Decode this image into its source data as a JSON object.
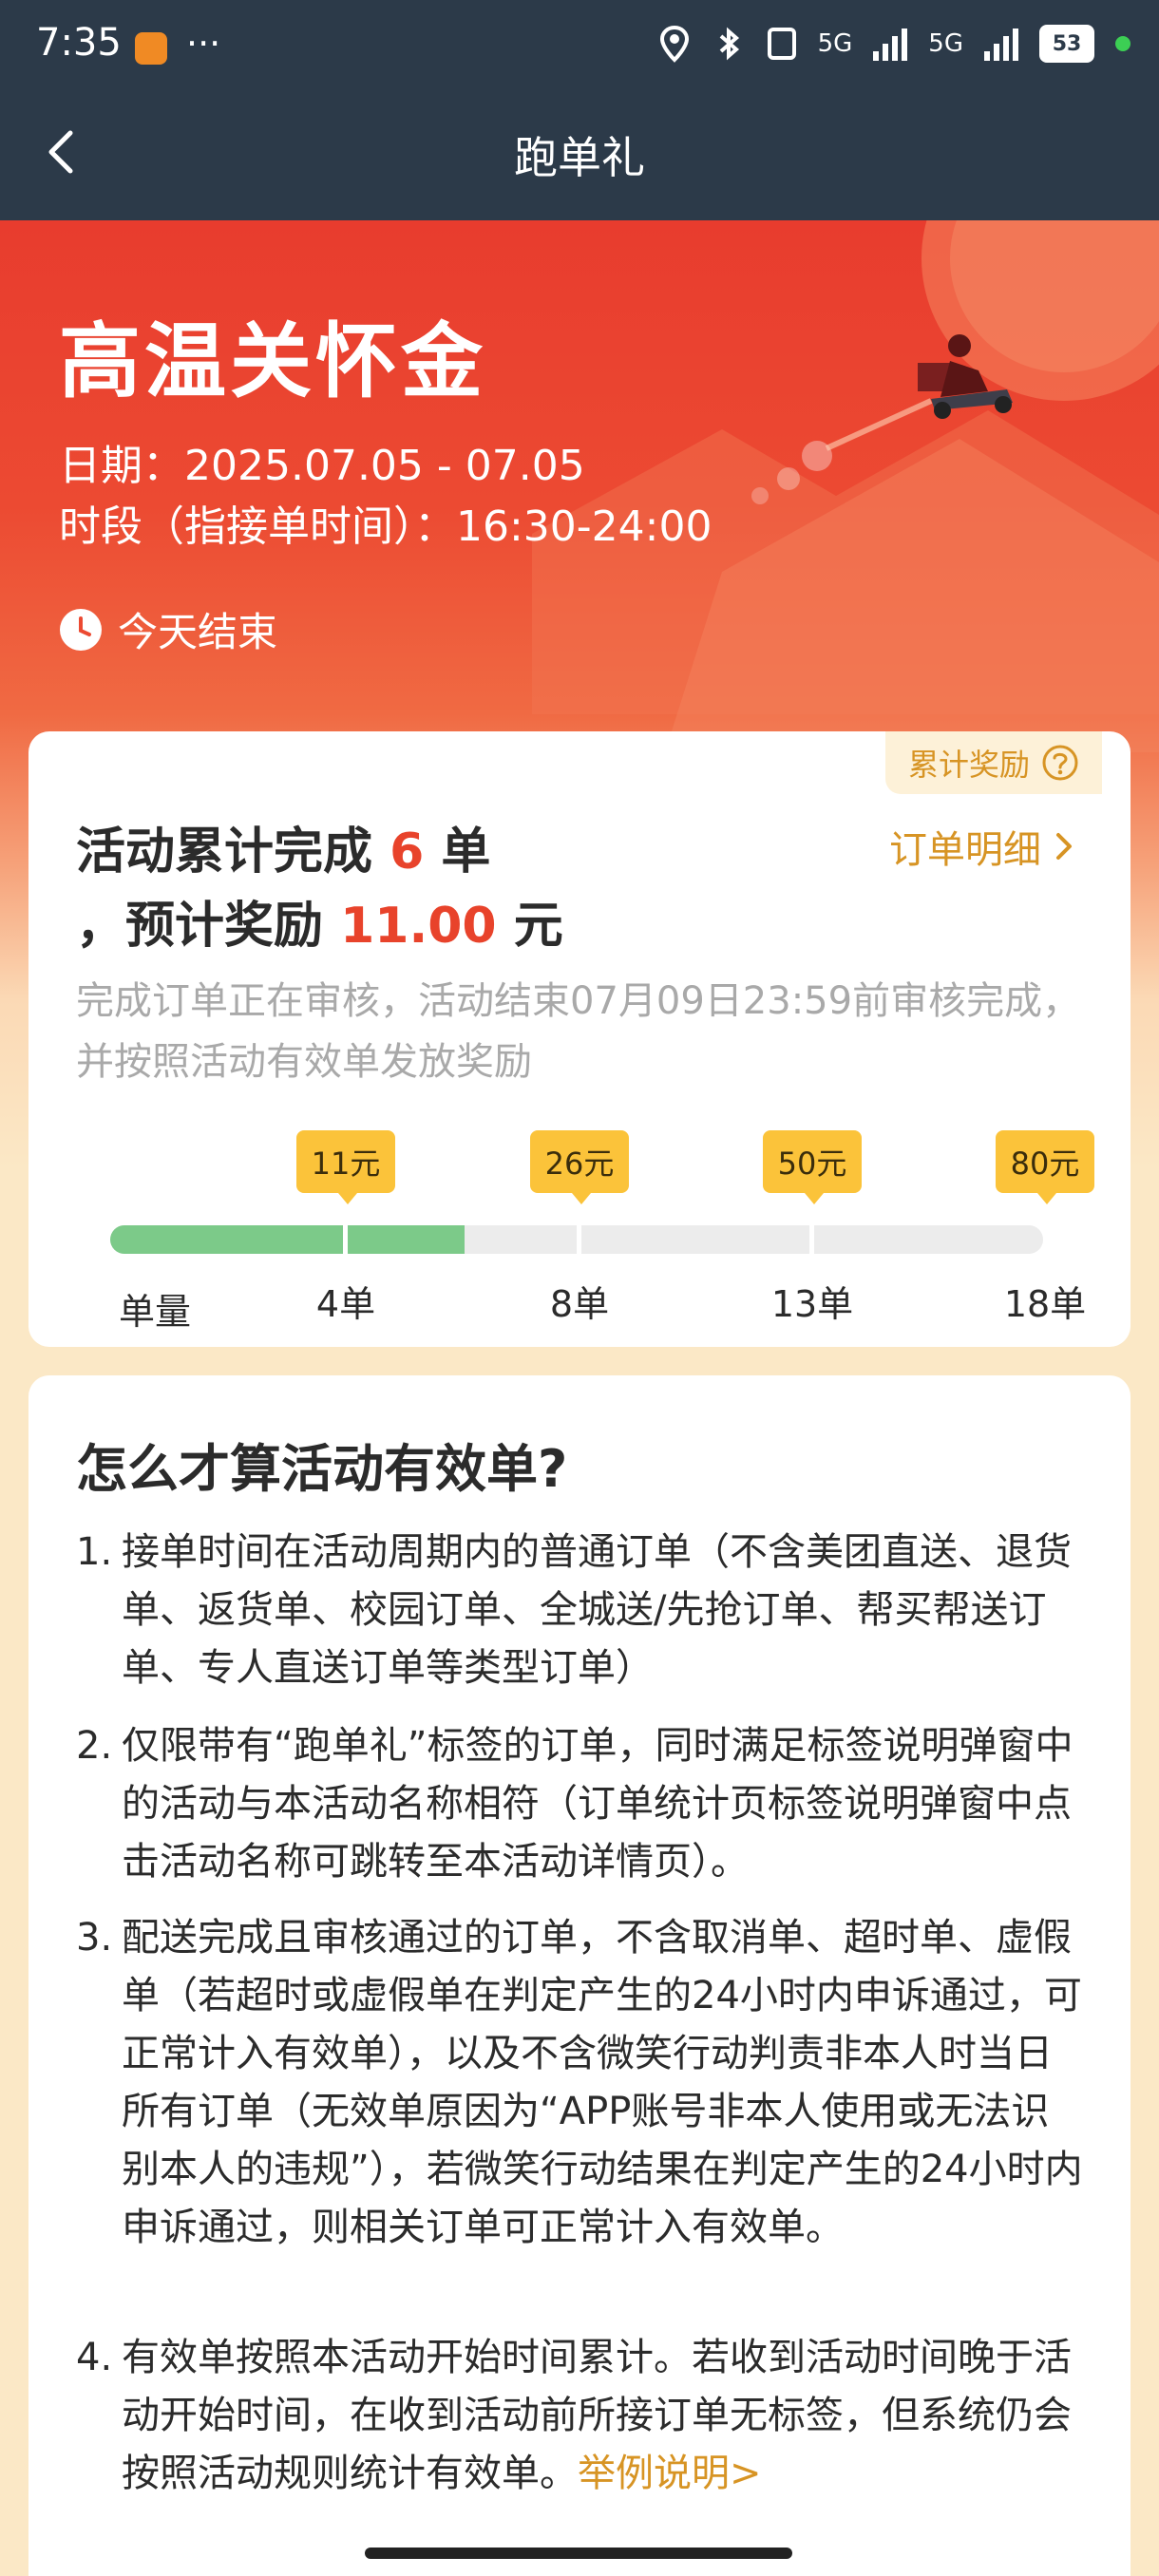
{
  "status_bar": {
    "time": "7:35",
    "more": "···",
    "network_1": "5G",
    "network_2": "5G",
    "battery": "53"
  },
  "nav": {
    "title": "跑单礼",
    "back_icon": "chevron-left-icon"
  },
  "hero": {
    "title": "高温关怀金",
    "date": "日期：2025.07.05 - 07.05",
    "period": "时段（指接单时间）：16:30-24:00",
    "ends": "今天结束"
  },
  "progress_card": {
    "reward_tag": "累计奖励",
    "completed_prefix": "活动累计完成",
    "completed_count": "6",
    "completed_unit": "单",
    "reward_prefix": "，预计奖励",
    "reward_amount": "11.00",
    "reward_unit": "元",
    "order_detail": "订单明细",
    "note": "完成订单正在审核，活动结束07月09日23:59前审核完成，并按照活动有效单发放奖励",
    "progress_fraction": 0.38,
    "milestones": [
      {
        "reward": "11元",
        "orders": "4单"
      },
      {
        "reward": "26元",
        "orders": "8单"
      },
      {
        "reward": "50元",
        "orders": "13单"
      },
      {
        "reward": "80元",
        "orders": "18单"
      }
    ],
    "axis_label": "单量"
  },
  "rules": {
    "title": "怎么才算活动有效单?",
    "items": [
      {
        "num": "1.",
        "text": "接单时间在活动周期内的普通订单（不含美团直送、退货单、返货单、校园订单、全城送/先抢订单、帮买帮送订单、专人直送订单等类型订单）"
      },
      {
        "num": "2.",
        "text": "仅限带有“跑单礼”标签的订单，同时满足标签说明弹窗中的活动与本活动名称相符（订单统计页标签说明弹窗中点击活动名称可跳转至本活动详情页）。"
      },
      {
        "num": "3.",
        "text": "配送完成且审核通过的订单，不含取消单、超时单、虚假单（若超时或虚假单在判定产生的24小时内申诉通过，可正常计入有效单），以及不含微笑行动判责非本人时当日所有订单（无效单原因为“APP账号非本人使用或无法识别本人的违规”），若微笑行动结果在判定产生的24小时内申诉通过，则相关订单可正常计入有效单。"
      },
      {
        "num": "4.",
        "text": "有效单按照本活动开始时间累计。若收到活动时间晚于活动开始时间，在收到活动前所接订单无标签，但系统仍会按照活动规则统计有效单。",
        "link": "举例说明>"
      }
    ]
  },
  "colors": {
    "brand_red": "#e8432b",
    "accent_gold": "#d79424",
    "badge_yellow": "#fbc33a",
    "progress_green": "#7cca89"
  }
}
